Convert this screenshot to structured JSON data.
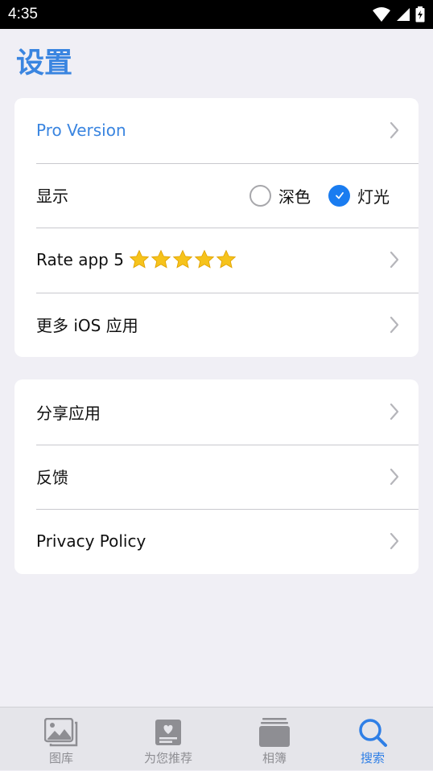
{
  "status_bar": {
    "time": "4:35"
  },
  "page": {
    "title": "设置"
  },
  "section1": {
    "pro": {
      "label": "Pro Version"
    },
    "display": {
      "label": "显示",
      "options": [
        {
          "label": "深色",
          "selected": false
        },
        {
          "label": "灯光",
          "selected": true
        }
      ]
    },
    "rate": {
      "label": "Rate app 5",
      "stars": 5
    },
    "more_apps": {
      "label": "更多 iOS 应用"
    }
  },
  "section2": {
    "share": {
      "label": "分享应用"
    },
    "feedback": {
      "label": "反馈"
    },
    "privacy": {
      "label": "Privacy Policy"
    }
  },
  "tab_bar": {
    "tabs": [
      {
        "label": "图库",
        "icon": "gallery-icon",
        "active": false
      },
      {
        "label": "为您推荐",
        "icon": "for-you-icon",
        "active": false
      },
      {
        "label": "相簿",
        "icon": "albums-icon",
        "active": false
      },
      {
        "label": "搜索",
        "icon": "search-icon",
        "active": true
      }
    ]
  },
  "colors": {
    "accent": "#3a85e0",
    "checkbox": "#1a7cf0",
    "star": "#f6c31c",
    "background": "#f0eff5",
    "tab_inactive": "#8e8e93"
  }
}
